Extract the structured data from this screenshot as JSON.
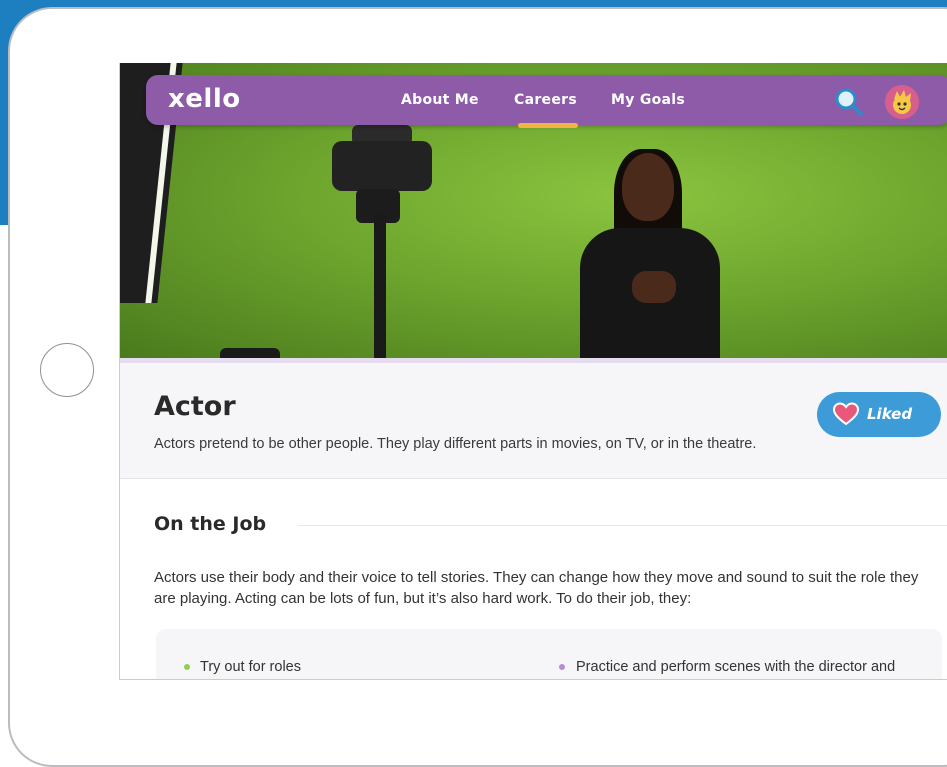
{
  "nav": {
    "logo": "xello",
    "items": [
      {
        "label": "About Me",
        "active": false
      },
      {
        "label": "Careers",
        "active": true
      },
      {
        "label": "My Goals",
        "active": false
      }
    ],
    "search_icon": "search-icon",
    "avatar_icon": "avatar-icon",
    "brand_color": "#8e5ba9",
    "active_underline_color": "#f2b441"
  },
  "career": {
    "title": "Actor",
    "description": "Actors pretend to be other people. They play different parts in movies, on TV, or in the theatre.",
    "liked_button": {
      "label": "Liked",
      "icon": "heart-icon",
      "color": "#3d9cd8"
    }
  },
  "on_the_job": {
    "heading": "On the Job",
    "body": "Actors use their body and their voice to tell stories. They can change how they move and sound to suit the role they are playing. Acting can be lots of fun, but it’s also hard work. To do their job, they:",
    "tasks": [
      "Try out for roles",
      "Practice and perform scenes with the director and"
    ]
  }
}
